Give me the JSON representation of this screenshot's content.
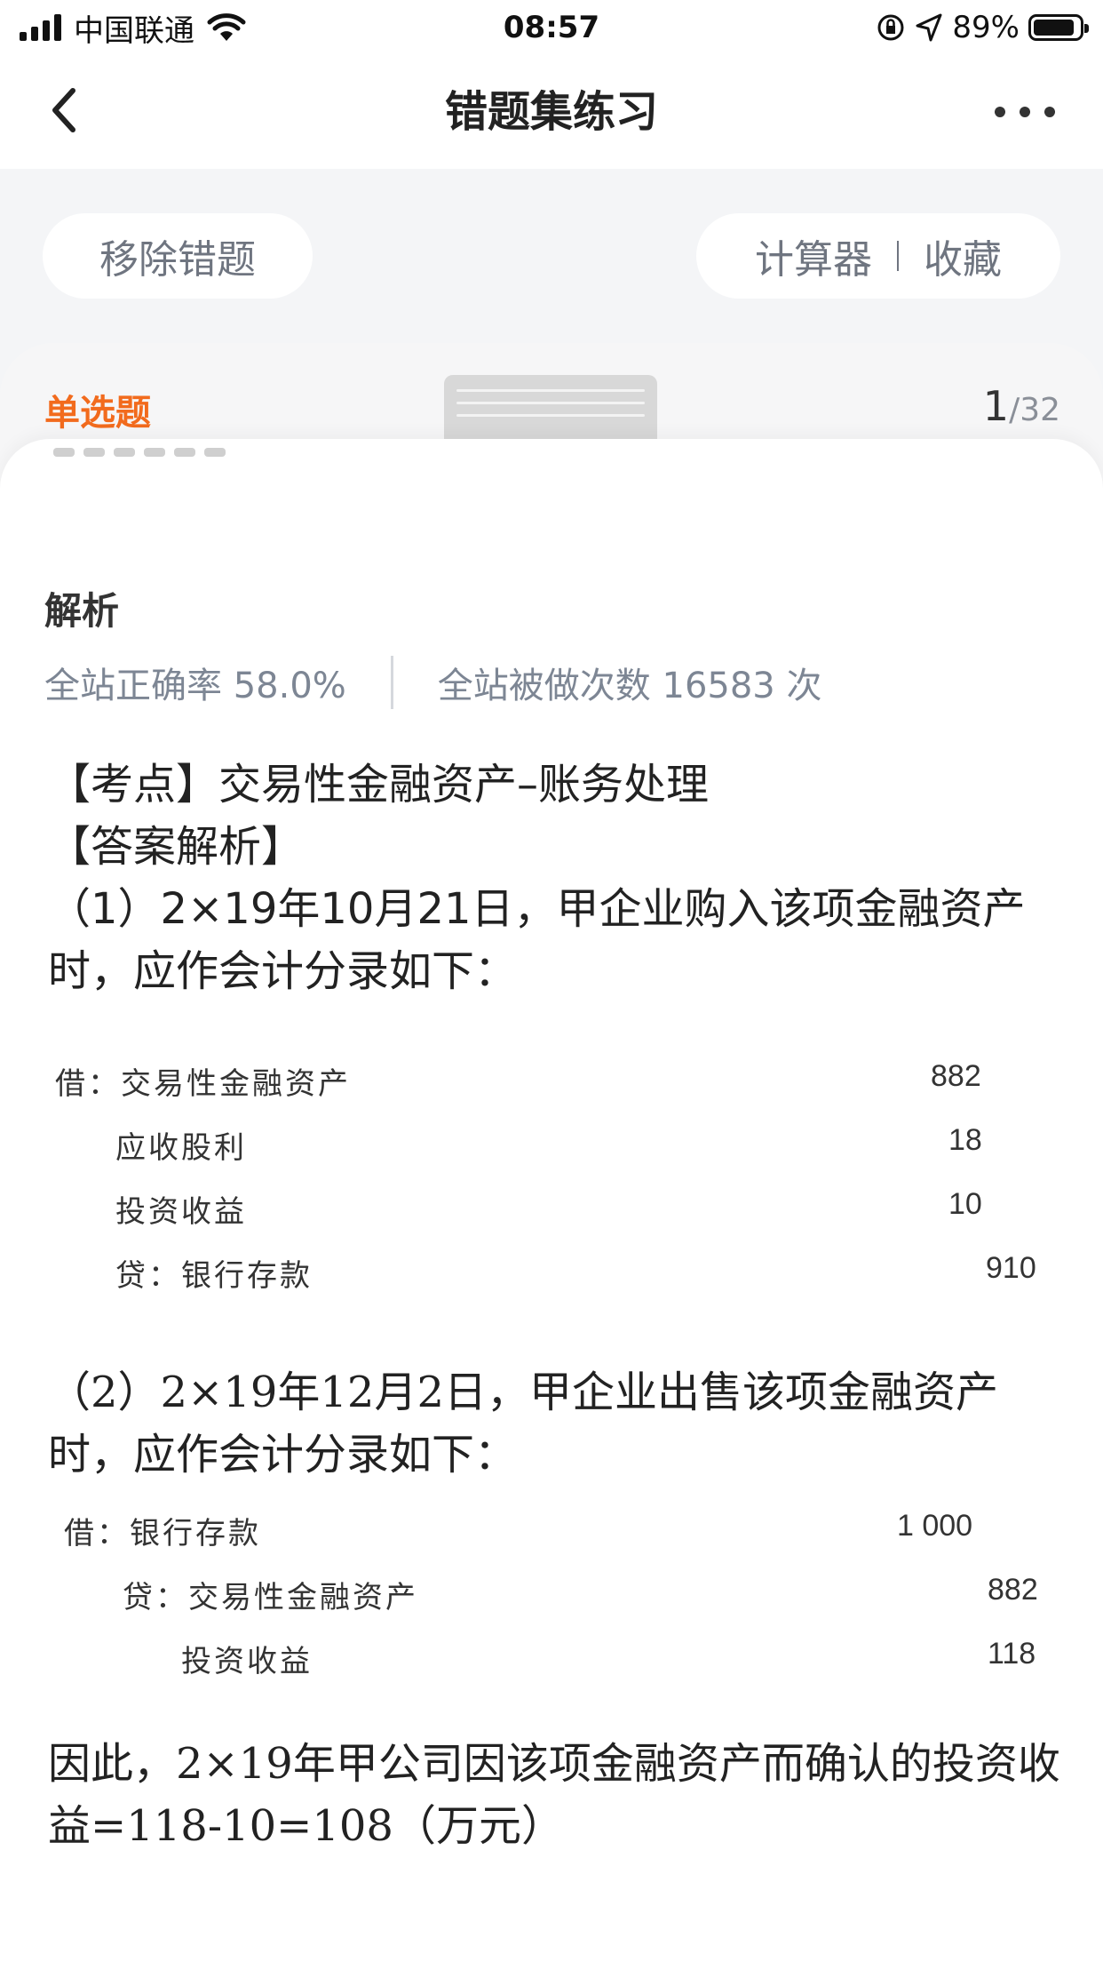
{
  "status_bar": {
    "carrier": "中国联通",
    "time": "08:57",
    "battery": "89%",
    "battery_level": 0.89
  },
  "nav": {
    "title": "错题集练习",
    "back_icon": "chevron-left-icon",
    "more_icon": "more-dots-icon"
  },
  "actions": {
    "remove": "移除错题",
    "calculator": "计算器",
    "favorite": "收藏"
  },
  "question": {
    "type": "单选题",
    "current": "1",
    "total": "/32"
  },
  "analysis": {
    "heading": "解析",
    "accuracy": "全站正确率 58.0%",
    "attempts": "全站被做次数 16583 次",
    "point": "【考点】交易性金融资产–账务处理",
    "answer_heading": "【答案解析】",
    "step1": "（1）2×19年10月21日，甲企业购入该项金融资产时，应作会计分录如下：",
    "entry1": [
      {
        "label": "借：交易性金融资产",
        "amount": "882"
      },
      {
        "label": "应收股利",
        "amount": "18"
      },
      {
        "label": "投资收益",
        "amount": "10"
      },
      {
        "label": "贷：银行存款",
        "amount": "910"
      }
    ],
    "step2": "（2）2×19年12月2日，甲企业出售该项金融资产时，应作会计分录如下：",
    "entry2": [
      {
        "label": "借：银行存款",
        "amount": "1 000"
      },
      {
        "label": "贷：交易性金融资产",
        "amount": "882"
      },
      {
        "label": "投资收益",
        "amount": "118"
      }
    ],
    "conclusion": "因此，2×19年甲公司因该项金融资产而确认的投资收益=118-10=108（万元）"
  }
}
